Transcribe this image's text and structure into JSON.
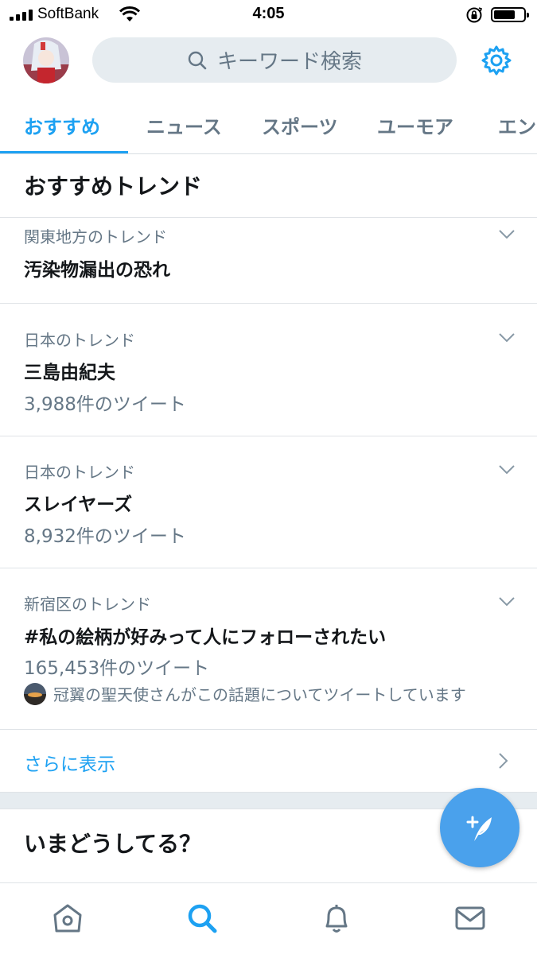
{
  "status_bar": {
    "carrier": "SoftBank",
    "time": "4:05"
  },
  "header": {
    "search_placeholder": "キーワード検索"
  },
  "tabs": [
    {
      "label": "おすすめ",
      "active": true
    },
    {
      "label": "ニュース",
      "active": false
    },
    {
      "label": "スポーツ",
      "active": false
    },
    {
      "label": "ユーモア",
      "active": false
    },
    {
      "label": "エン",
      "active": false
    }
  ],
  "section_title": "おすすめトレンド",
  "trends": [
    {
      "context": "関東地方のトレンド",
      "name": "汚染物漏出の恐れ",
      "count": ""
    },
    {
      "context": "日本のトレンド",
      "name": "三島由紀夫",
      "count": "3,988件のツイート"
    },
    {
      "context": "日本のトレンド",
      "name": "スレイヤーズ",
      "count": "8,932件のツイート"
    },
    {
      "context": "新宿区のトレンド",
      "name": "#私の絵柄が好みって人にフォローされたい",
      "count": "165,453件のツイート",
      "tweeting": "冠翼の聖天使さんがこの話題についてツイートしています"
    }
  ],
  "show_more": "さらに表示",
  "whats_happening": "いまどうしてる？",
  "colors": {
    "accent": "#1da1f2",
    "fab": "#4aa1ec",
    "secondary_text": "#657786",
    "band": "#e6ecf0"
  },
  "icons": [
    "settings-gear-icon",
    "search-icon",
    "chevron-down-icon",
    "chevron-right-icon",
    "compose-tweet-icon",
    "home-icon",
    "notifications-bell-icon",
    "messages-envelope-icon"
  ]
}
